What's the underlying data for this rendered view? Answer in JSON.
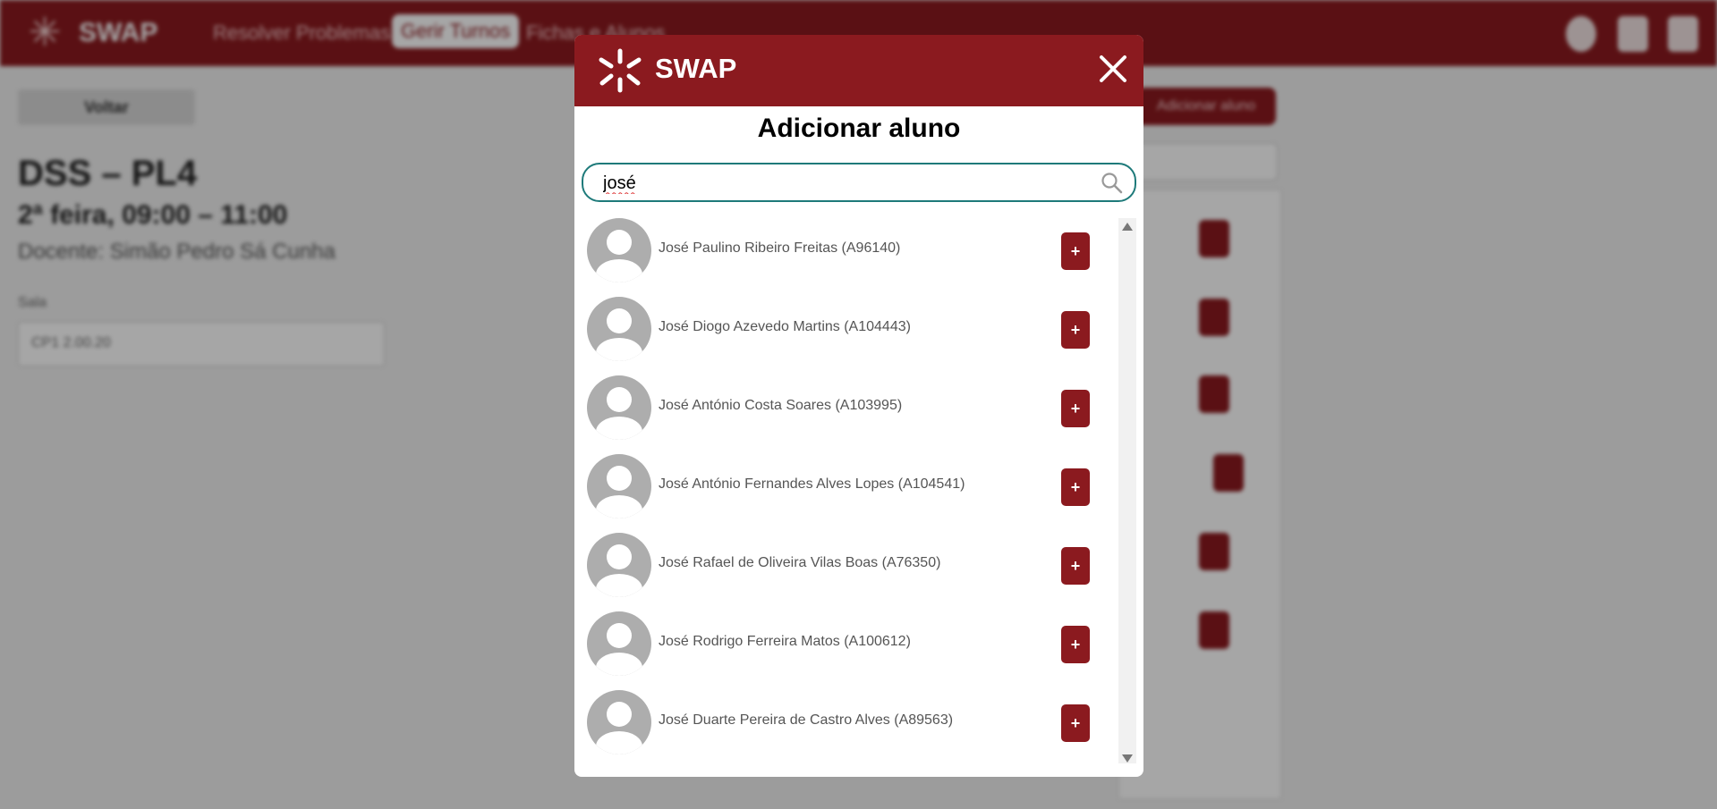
{
  "app": {
    "brand": "SWAP",
    "nav": [
      "Resolver Problemas",
      "Gerir Turnos",
      "Fichas e Alunos"
    ]
  },
  "background": {
    "back_label": "Voltar",
    "title": "DSS – PL4",
    "schedule": "2ª feira, 09:00 – 11:00",
    "teacher": "Docente: Simão Pedro Sá Cunha",
    "room_label": "Sala",
    "room_value": "CP1 2.00.20",
    "add_student_label": "Adicionar aluno"
  },
  "modal": {
    "brand": "SWAP",
    "title": "Adicionar aluno",
    "search_value": "josé",
    "add_label": "+",
    "students": [
      {
        "name": "José Paulino Ribeiro Freitas (A96140)"
      },
      {
        "name": "José Diogo Azevedo Martins (A104443)"
      },
      {
        "name": "José António Costa Soares (A103995)"
      },
      {
        "name": "José António Fernandes Alves Lopes (A104541)"
      },
      {
        "name": "José Rafael de Oliveira Vilas Boas (A76350)"
      },
      {
        "name": "José Rodrigo Ferreira Matos (A100612)"
      },
      {
        "name": "José Duarte Pereira de Castro Alves (A89563)"
      }
    ]
  },
  "colors": {
    "brand": "#8b1a1f",
    "search_border": "#1e7a7a",
    "avatar": "#adadad"
  },
  "icons": {
    "logo": "swap-logo-icon",
    "close": "close-icon",
    "search": "search-icon",
    "avatar": "user-avatar-icon"
  }
}
